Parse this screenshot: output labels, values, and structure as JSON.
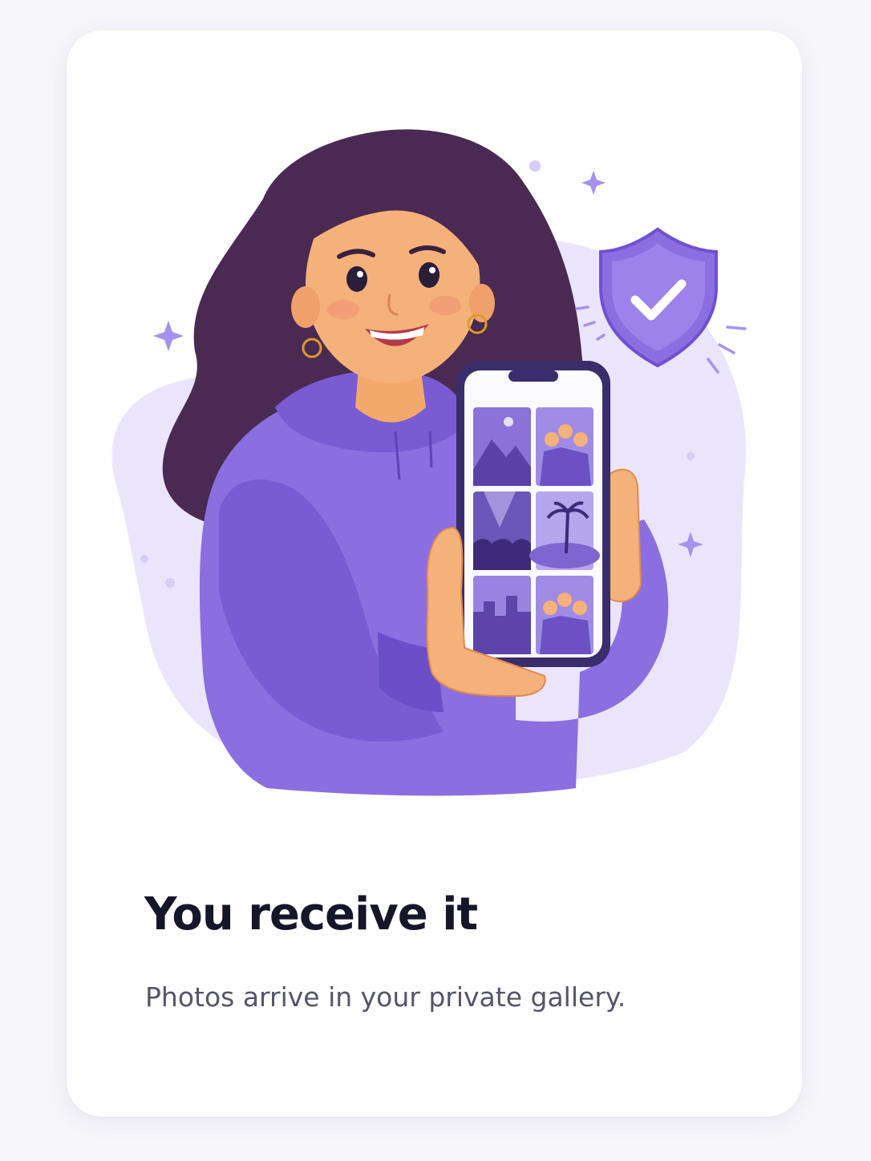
{
  "card": {
    "title": "You receive it",
    "subtitle": "Photos arrive in your private gallery."
  },
  "illustration": {
    "subject": "woman-holding-phone",
    "badge_icon": "shield-check-icon",
    "gallery_thumbnails": [
      "mountain",
      "friends",
      "concert",
      "palm-beach",
      "city",
      "group"
    ]
  },
  "colors": {
    "accent": "#8b6ee0",
    "accent_light": "#ebe5fb",
    "title_text": "#16162a",
    "body_text": "#55556a",
    "card_bg": "#fefefe",
    "page_bg": "#f6f5fa"
  }
}
